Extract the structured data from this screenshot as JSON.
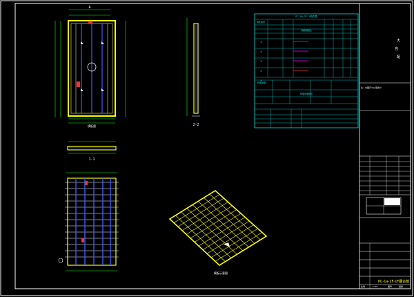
{
  "views": {
    "plan_mark_top": "A",
    "section_label_1": "1-1",
    "section_label_2": "2-2",
    "plan_caption": "模板图",
    "iso_caption": "模板示意图"
  },
  "table": {
    "title": "PC-1a-2F-1构件表",
    "head_first": "构件编号",
    "rebar_title": "钢筋明细表",
    "embed_title": "预埋件明细表",
    "note_title": "构件说明",
    "rows": [
      "①",
      "②",
      "③",
      "④",
      "⑤"
    ]
  },
  "title_block": {
    "company_1": "大",
    "company_2": "自",
    "company_3": "配",
    "note": "注：本图尺寸以毫米计",
    "drawing_name": "PC-1a-2F-1F叠合板",
    "scale_label": "比例",
    "scale_value": "1:50",
    "sheet_label": "图号",
    "sheet_value": "结施"
  },
  "colors": {
    "frame": "#ffffff",
    "concrete": "#ffff00",
    "rebar_main": "#3b5bff",
    "rebar_cross": "#ffffff",
    "table_line": "#00e5e5",
    "dim": "#00ff00",
    "accent": "#ff3030",
    "truss": "#ff00ff"
  }
}
